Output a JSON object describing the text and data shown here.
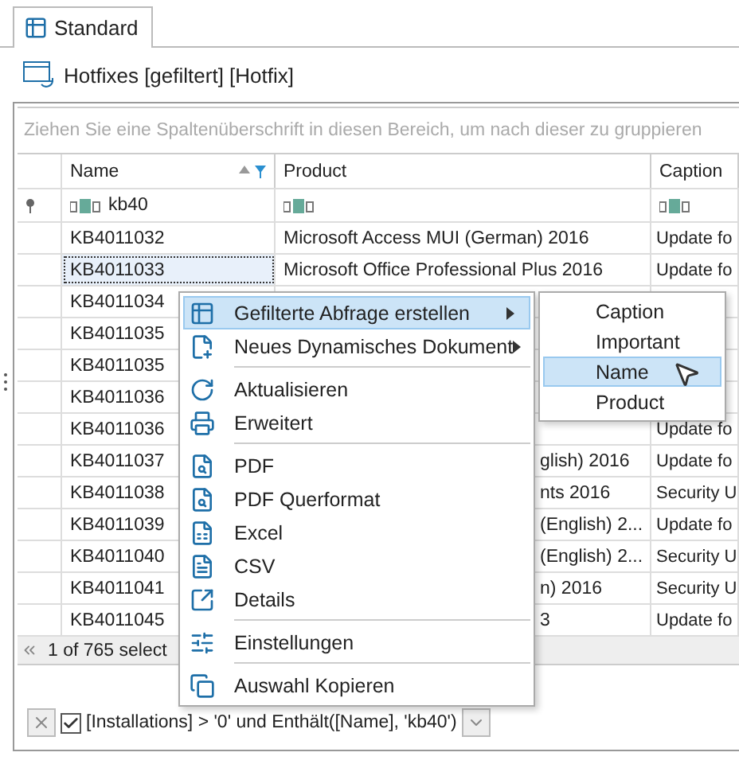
{
  "tab": {
    "label": "Standard",
    "selected": true
  },
  "title": "Hotfixes [gefiltert] [Hotfix]",
  "grid": {
    "group_panel_placeholder": "Ziehen Sie eine Spaltenüberschrift in diesen Bereich, um nach dieser zu gruppieren",
    "columns": [
      {
        "label": "Name",
        "sorted": true,
        "filtered": true
      },
      {
        "label": "Product",
        "sorted": false,
        "filtered": false
      },
      {
        "label": "Caption",
        "sorted": false,
        "filtered": false
      }
    ],
    "filter_row": {
      "name": "kb40"
    },
    "rows": [
      {
        "name": "KB4011032",
        "product": "Microsoft Access MUI (German) 2016",
        "caption": "Update fo",
        "selected": false
      },
      {
        "name": "KB4011033",
        "product": "Microsoft Office Professional Plus 2016",
        "caption": "Update fo",
        "selected": true
      },
      {
        "name": "KB4011034",
        "selected": false
      },
      {
        "name": "KB4011035",
        "selected": false
      },
      {
        "name": "KB4011035",
        "selected": false
      },
      {
        "name": "KB4011036",
        "selected": false
      },
      {
        "name": "KB4011036",
        "caption": "Update fo",
        "selected": false
      },
      {
        "name": "KB4011037",
        "product": "glish) 2016",
        "caption": "Update fo",
        "selected": false
      },
      {
        "name": "KB4011038",
        "product": "nts 2016",
        "caption": "Security U",
        "selected": false
      },
      {
        "name": "KB4011039",
        "product": "(English) 2...",
        "caption": "Update fo",
        "selected": false
      },
      {
        "name": "KB4011040",
        "product": "(English) 2...",
        "caption": "Security U",
        "selected": false
      },
      {
        "name": "KB4011041",
        "product": "n) 2016",
        "caption": "Security U",
        "selected": false
      },
      {
        "name": "KB4011045",
        "product": "3",
        "caption": "Update fo",
        "selected": false
      }
    ],
    "footer": "1 of 765 select"
  },
  "filter_bar": {
    "enabled": true,
    "expression": "[Installations] > '0' und Enthält([Name], 'kb40')"
  },
  "context_menu": {
    "items": [
      {
        "kind": "item",
        "label": "Gefilterte Abfrage erstellen",
        "selected": true,
        "submenu": true
      },
      {
        "kind": "item",
        "label": "Neues Dynamisches Dokument",
        "selected": false,
        "submenu": true
      },
      {
        "kind": "separator"
      },
      {
        "kind": "item",
        "label": "Aktualisieren",
        "selected": false,
        "submenu": false
      },
      {
        "kind": "item",
        "label": "Erweitert",
        "selected": false,
        "submenu": false
      },
      {
        "kind": "separator"
      },
      {
        "kind": "item",
        "label": "PDF",
        "selected": false,
        "submenu": false
      },
      {
        "kind": "item",
        "label": "PDF Querformat",
        "selected": false,
        "submenu": false
      },
      {
        "kind": "item",
        "label": "Excel",
        "selected": false,
        "submenu": false
      },
      {
        "kind": "item",
        "label": "CSV",
        "selected": false,
        "submenu": false
      },
      {
        "kind": "item",
        "label": "Details",
        "selected": false,
        "submenu": false
      },
      {
        "kind": "separator"
      },
      {
        "kind": "item",
        "label": "Einstellungen",
        "selected": false,
        "submenu": false
      },
      {
        "kind": "separator"
      },
      {
        "kind": "item",
        "label": "Auswahl Kopieren",
        "selected": false,
        "submenu": false
      }
    ]
  },
  "submenu": {
    "items": [
      {
        "label": "Caption",
        "selected": false
      },
      {
        "label": "Important",
        "selected": false
      },
      {
        "label": "Name",
        "selected": true
      },
      {
        "label": "Product",
        "selected": false
      }
    ]
  }
}
